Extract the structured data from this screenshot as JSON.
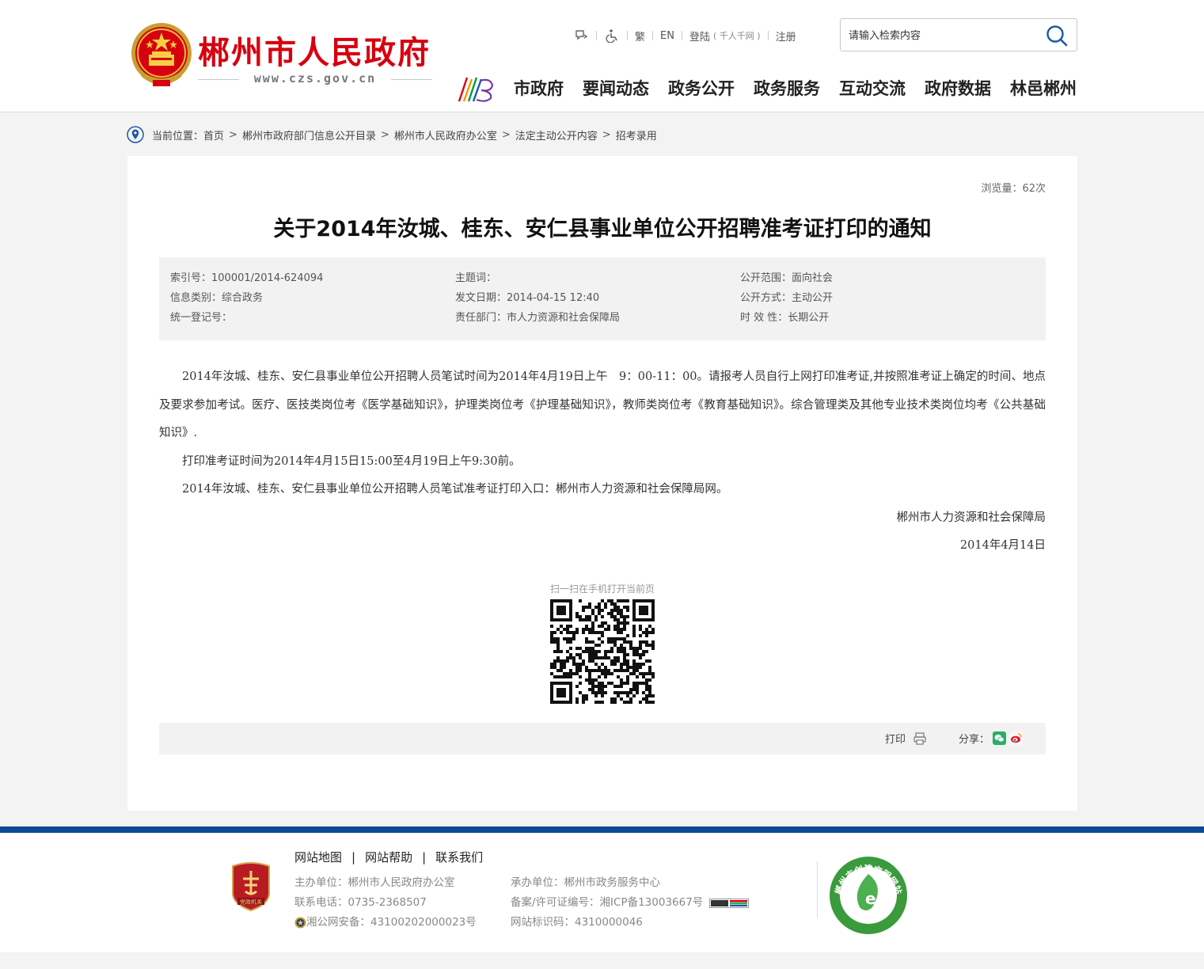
{
  "header": {
    "site_title": "郴州市人民政府",
    "site_url": "www.czs.gov.cn",
    "toplinks": {
      "traditional": "繁",
      "english": "EN",
      "login": "登陆",
      "login_note": "( 千人千网 )",
      "register": "注册"
    },
    "search": {
      "placeholder": "请输入检索内容"
    },
    "nav": [
      "市政府",
      "要闻动态",
      "政务公开",
      "政务服务",
      "互动交流",
      "政府数据",
      "林邑郴州"
    ]
  },
  "breadcrumb": {
    "lead": "当前位置：",
    "items": [
      "首页",
      "郴州市政府部门信息公开目录",
      "郴州市人民政府办公室",
      "法定主动公开内容",
      "招考录用"
    ]
  },
  "article": {
    "views_label": "浏览量：",
    "views_count": "62次",
    "title": "关于2014年汝城、桂东、安仁县事业单位公开招聘准考证打印的通知",
    "meta": {
      "index_no": "索引号：100001/2014-624094",
      "category": "信息类别：综合政务",
      "reg_no": "统一登记号：",
      "keywords": "主题词：",
      "date": "发文日期：2014-04-15 12:40",
      "department": "责任部门：市人力资源和社会保障局",
      "scope": "公开范围：面向社会",
      "method": "公开方式：主动公开",
      "validity": "时 效 性：长期公开"
    },
    "paragraphs": [
      "2014年汝城、桂东、安仁县事业单位公开招聘人员笔试时间为2014年4月19日上午　9：00-11：00。请报考人员自行上网打印准考证,并按照准考证上确定的时间、地点及要求参加考试。医疗、医技类岗位考《医学基础知识》，护理类岗位考《护理基础知识》，教师类岗位考《教育基础知识》。综合管理类及其他专业技术类岗位均考《公共基础知识》.",
      "打印准考证时间为2014年4月15日15:00至4月19日上午9:30前。",
      "2014年汝城、桂东、安仁县事业单位公开招聘人员笔试准考证打印入口：郴州市人力资源和社会保障局网。"
    ],
    "signature": "郴州市人力资源和社会保障局",
    "sign_date": "2014年4月14日",
    "qr_caption": "扫一扫在手机打开当前页",
    "print_label": "打印",
    "share_label": "分享："
  },
  "footer": {
    "links": [
      "网站地图",
      "网站帮助",
      "联系我们"
    ],
    "host": "主办单位：郴州市人民政府办公室",
    "phone": "联系电话：0735-2368507",
    "police": "湘公网安备：43100202000023号",
    "operator": "承办单位：郴州市政务服务中心",
    "icp": "备案/许可证编号：湘ICP备13003667号",
    "site_id": "网站标识码：4310000046",
    "badge_text": "党政机关",
    "civil_text": "郴州市创建文明网站"
  },
  "colors": {
    "title_red": "#d7000f",
    "footer_blue": "#0d4a94",
    "meta_bg": "#f2f2f2",
    "page_bg": "#f3f3f3"
  }
}
